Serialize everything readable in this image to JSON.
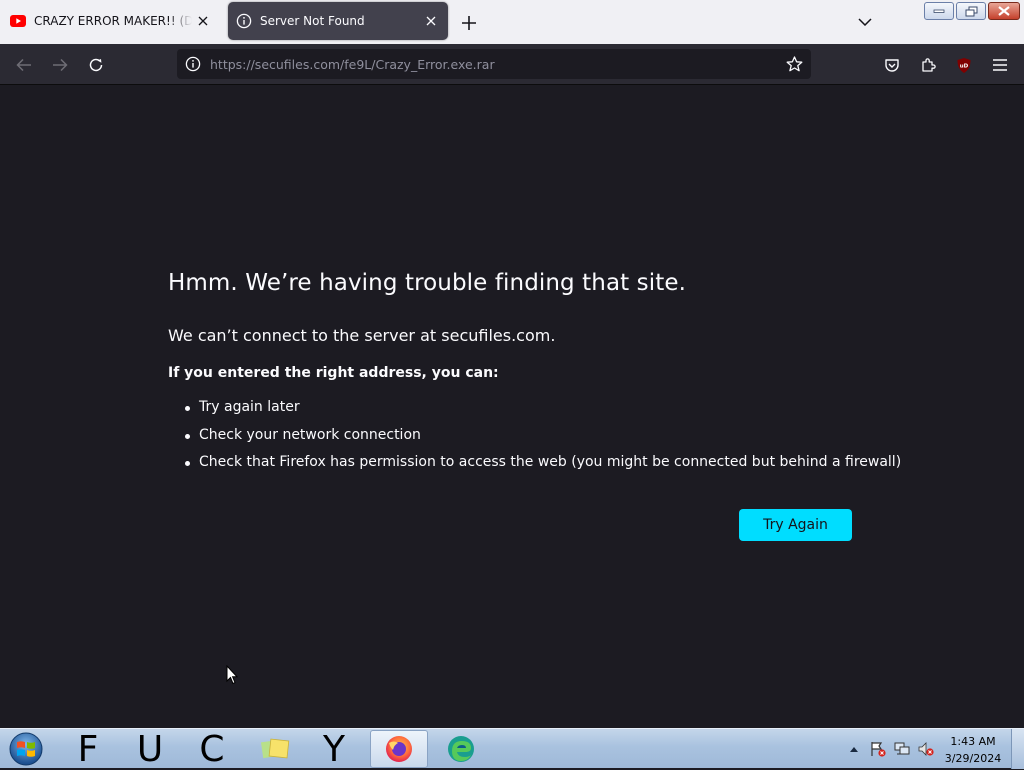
{
  "tabs": [
    {
      "title": "CRAZY ERROR MAKER!! (DOWNLOAD)",
      "favicon": "youtube-icon",
      "active": false
    },
    {
      "title": "Server Not Found",
      "favicon": "info-icon",
      "active": true
    }
  ],
  "toolbar": {
    "url_host": "https://secufiles.com",
    "url_path": "/fe9L/Crazy_Error.exe.rar"
  },
  "error_page": {
    "title": "Hmm. We’re having trouble finding that site.",
    "subtitle": "We can’t connect to the server at secufiles.com.",
    "hint": "If you entered the right address, you can:",
    "suggestions": [
      "Try again later",
      "Check your network connection",
      "Check that Firefox has permission to access the web (you might be connected but behind a firewall)"
    ],
    "button_label": "Try Again",
    "button_color": "#00ddff"
  },
  "taskbar": {
    "letters": [
      "F",
      "U",
      "C",
      "Y"
    ],
    "clock_time": "1:43 AM",
    "clock_date": "3/29/2024"
  },
  "colors": {
    "page_bg": "#1c1b22",
    "toolbar_bg": "#2b2a33",
    "tabstrip_bg": "#f0f0f4"
  }
}
